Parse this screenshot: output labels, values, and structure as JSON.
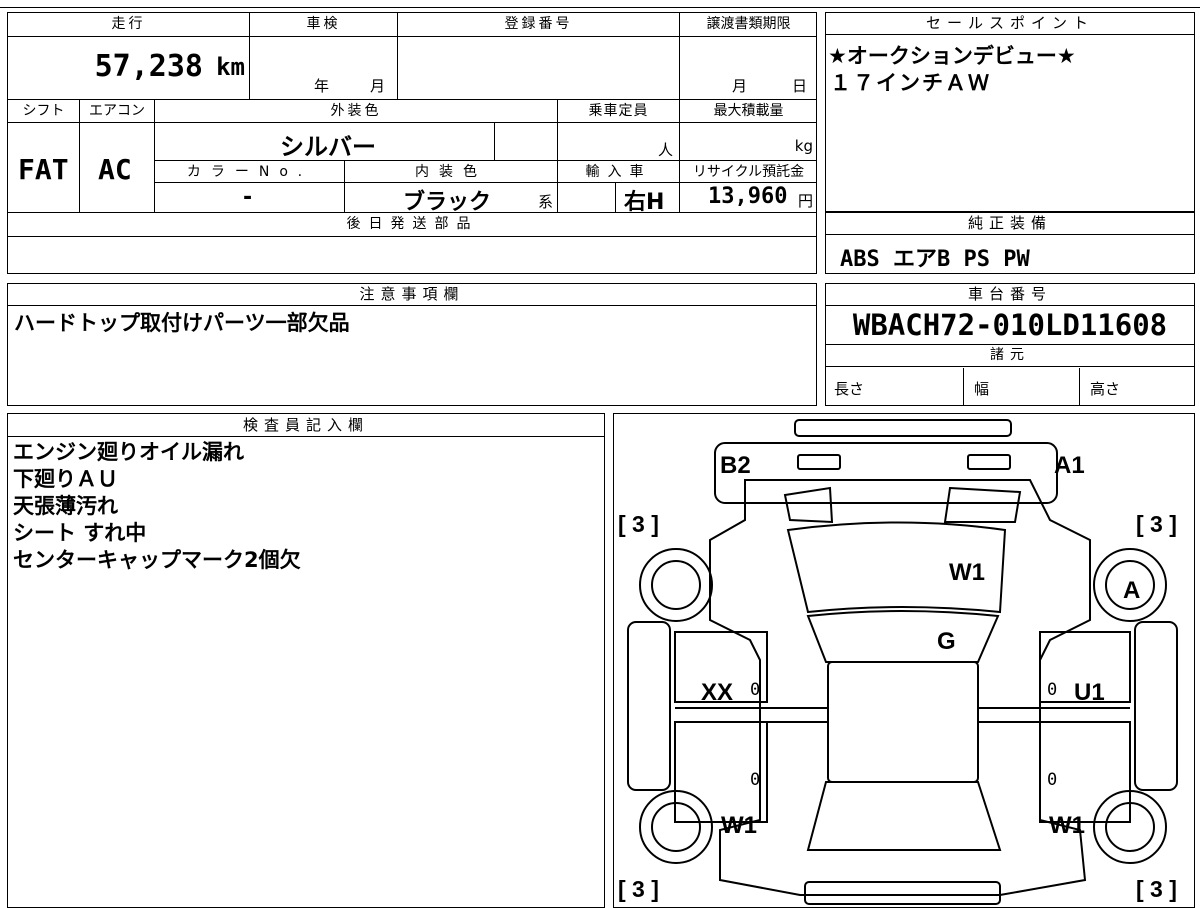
{
  "vehicle_info": {
    "mileage_label": "走行",
    "mileage_value": "57,238",
    "mileage_unit": "km",
    "inspection_label": "車検",
    "inspection_year_unit": "年",
    "inspection_month_unit": "月",
    "registration_label": "登録番号",
    "transfer_deadline_label": "譲渡書類期限",
    "transfer_month_unit": "月",
    "transfer_day_unit": "日",
    "shift_label": "シフト",
    "shift_value": "FAT",
    "ac_label": "エアコン",
    "ac_value": "AC",
    "exterior_color_label": "外装色",
    "exterior_color_value": "シルバー",
    "capacity_label": "乗車定員",
    "capacity_unit": "人",
    "max_load_label": "最大積載量",
    "max_load_unit": "kg",
    "color_no_label": "カラーNo.",
    "color_no_value": "-",
    "interior_color_label": "内装色",
    "interior_color_value": "ブラック",
    "interior_color_suffix": "系",
    "import_label": "輸入車",
    "import_value": "右H",
    "recycle_label": "リサイクル預託金",
    "recycle_value": "13,960",
    "recycle_unit": "円",
    "later_parts_label": "後日発送部品"
  },
  "sales_points": {
    "label": "セールスポイント",
    "lines": [
      "★オークションデビュー★",
      "１７インチＡＷ"
    ]
  },
  "standard_equipment": {
    "label": "純正装備",
    "value": "ABS エアB PS PW"
  },
  "caution": {
    "label": "注意事項欄",
    "value": "ハードトップ取付けパーツ一部欠品"
  },
  "chassis": {
    "label": "車台番号",
    "value": "WBACH72-010LD11608",
    "specs_label": "諸元",
    "length_label": "長さ",
    "width_label": "幅",
    "height_label": "高さ"
  },
  "inspector": {
    "label": "検査員記入欄",
    "lines": [
      "エンジン廻りオイル漏れ",
      "下廻りＡＵ",
      "天張薄汚れ",
      "シート すれ中",
      "センターキャップマーク2個欠"
    ]
  },
  "diagram": {
    "marks": {
      "b2": "B2",
      "a1": "A1",
      "w1_top": "W1",
      "a_right": "A",
      "g": "G",
      "xx": "XX",
      "u1": "U1",
      "w1_left": "W1",
      "w1_right": "W1"
    },
    "brackets": {
      "tl": "[ 3 ]",
      "tr": "[ 3 ]",
      "bl": "[ 3 ]",
      "br": "[ 3 ]"
    },
    "zeros": {
      "z1": "0",
      "z2": "0",
      "z3": "0",
      "z4": "0"
    }
  }
}
